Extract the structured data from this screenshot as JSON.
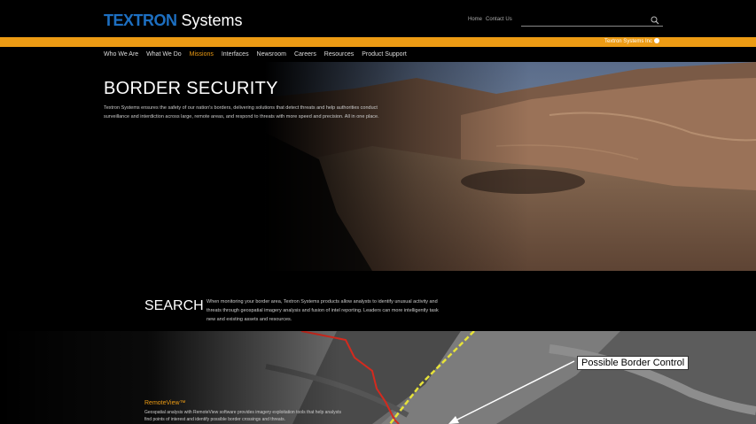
{
  "header": {
    "logo_brand": "TEXTRON",
    "logo_sub": "Systems",
    "util_links": [
      "Home",
      "Contact Us"
    ],
    "search_placeholder": "",
    "banner_link": "Textron Systems Inc"
  },
  "nav": {
    "items": [
      "Who We Are",
      "What We Do",
      "Missions",
      "Interfaces",
      "Newsroom",
      "Careers",
      "Resources",
      "Product Support"
    ],
    "active_index": 2
  },
  "hero": {
    "title": "BORDER SECURITY",
    "body": "Textron Systems ensures the safety of our nation's borders, delivering solutions that detect threats and help authorities conduct surveillance and interdiction across large, remote areas, and respond to threats with more speed and precision. All in one place."
  },
  "search_section": {
    "title": "SEARCH",
    "body": "When monitoring your border area, Textron Systems products allow analysts to identify unusual activity and threats through geospatial imagery analysis and fusion of intel reporting. Leaders can more intelligently task new and existing assets and resources."
  },
  "map": {
    "callout": "Possible Border Control",
    "feature_title": "RemoteView™",
    "feature_body": "Geospatial analysis with RemoteView software provides imagery exploitation tools that help analysts find points of interest and identify possible border crossings and threats."
  },
  "colors": {
    "accent": "#ec9b14",
    "brand": "#1d6fc1",
    "border_line": "#d42a1e",
    "road_line": "#e6e23a"
  }
}
